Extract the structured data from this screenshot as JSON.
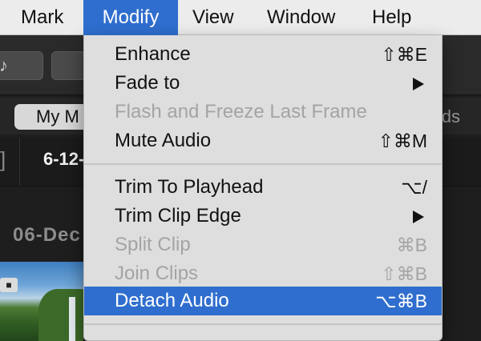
{
  "menubar": {
    "items": [
      "Mark",
      "Modify",
      "View",
      "Window",
      "Help"
    ]
  },
  "app": {
    "tab_pill": "My M",
    "tab_right": "ds",
    "event_strip_date": "6-12-",
    "event_date": "06-Dec"
  },
  "modify_menu": {
    "items": [
      {
        "label": "Enhance",
        "shortcut": "⇧⌘E",
        "enabled": true
      },
      {
        "label": "Fade to",
        "submenu": true,
        "enabled": true
      },
      {
        "label": "Flash and Freeze Last Frame",
        "enabled": false
      },
      {
        "label": "Mute Audio",
        "shortcut": "⇧⌘M",
        "enabled": true
      },
      {
        "label": "Trim To Playhead",
        "shortcut": "⌥/",
        "enabled": true
      },
      {
        "label": "Trim Clip Edge",
        "submenu": true,
        "enabled": true
      },
      {
        "label": "Split Clip",
        "shortcut": "⌘B",
        "enabled": false
      },
      {
        "label": "Join Clips",
        "shortcut": "⇧⌘B",
        "enabled": false
      },
      {
        "label": "Detach Audio",
        "shortcut": "⌥⌘B",
        "enabled": true,
        "selected": true
      }
    ],
    "selected_color": "#2f6ece"
  }
}
